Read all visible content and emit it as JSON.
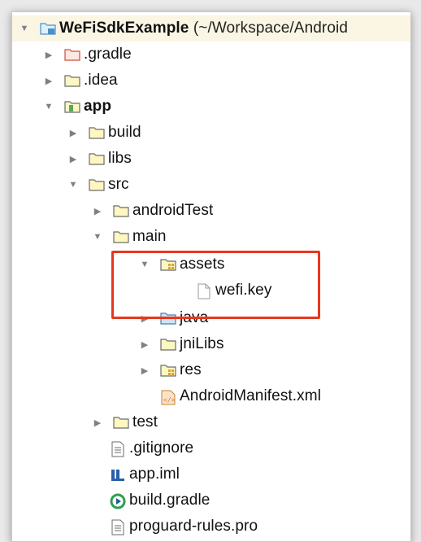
{
  "tree": {
    "project": {
      "name": "WeFiSdkExample",
      "path": " (~/Workspace/Android"
    },
    "items": {
      "gradle": ".gradle",
      "idea": ".idea",
      "app": "app",
      "build": "build",
      "libs": "libs",
      "src": "src",
      "androidTest": "androidTest",
      "main": "main",
      "assets": "assets",
      "wefi_key": "wefi.key",
      "java": "java",
      "jniLibs": "jniLibs",
      "res": "res",
      "manifest": "AndroidManifest.xml",
      "test": "test",
      "gitignore": ".gitignore",
      "app_iml": "app.iml",
      "build_gradle": "build.gradle",
      "proguard": "proguard-rules.pro"
    }
  },
  "colors": {
    "highlight_box": "#e8371f",
    "selected_row": "#fbf5e4",
    "folder_fill": "#fff7c2",
    "folder_stroke": "#6b6b6b",
    "excluded_folder_stroke": "#d44b3b",
    "source_folder_fill": "#cfe3f5"
  },
  "icons": {
    "expanded": "triangle-down-icon",
    "collapsed": "triangle-right-icon",
    "folder": "folder-icon",
    "file": "file-icon"
  }
}
